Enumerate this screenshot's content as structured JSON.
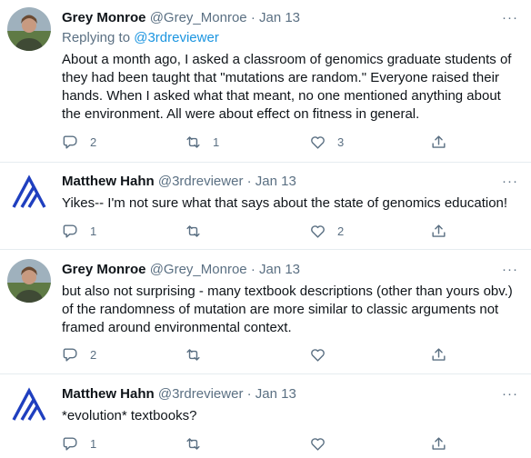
{
  "tweets": [
    {
      "name": "Grey Monroe",
      "handle": "@Grey_Monroe",
      "separator": "·",
      "date": "Jan 13",
      "avatar": "photo-avatar",
      "replying_prefix": "Replying to ",
      "replying_to": "@3rdreviewer",
      "text": "About a month ago, I asked a classroom of genomics graduate students of they had been taught that \"mutations are random.\" Everyone raised their hands. When I asked what that meant, no one mentioned anything about the environment. All were about effect on fitness in general.",
      "replies": "2",
      "retweets": "1",
      "likes": "3"
    },
    {
      "name": "Matthew Hahn",
      "handle": "@3rdreviewer",
      "separator": "·",
      "date": "Jan 13",
      "avatar": "logo-avatar",
      "text": "Yikes-- I'm not sure what that says about the state of genomics education!",
      "replies": "1",
      "retweets": "",
      "likes": "2"
    },
    {
      "name": "Grey Monroe",
      "handle": "@Grey_Monroe",
      "separator": "·",
      "date": "Jan 13",
      "avatar": "photo-avatar",
      "text": "but also not surprising - many textbook descriptions (other than yours obv.) of the randomness of mutation are more similar to classic arguments not framed around environmental context.",
      "replies": "2",
      "retweets": "",
      "likes": ""
    },
    {
      "name": "Matthew Hahn",
      "handle": "@3rdreviewer",
      "separator": "·",
      "date": "Jan 13",
      "avatar": "logo-avatar",
      "text": "*evolution* textbooks?",
      "replies": "1",
      "retweets": "",
      "likes": ""
    }
  ],
  "icons": {
    "more": "more-icon",
    "reply": "reply-icon",
    "retweet": "retweet-icon",
    "like": "like-icon",
    "share": "share-icon"
  },
  "colors": {
    "text": "#0f1419",
    "secondary": "#5b7083",
    "link": "#1b95e0",
    "divider": "#e6ecf0",
    "logo": "#1f3fbf"
  }
}
